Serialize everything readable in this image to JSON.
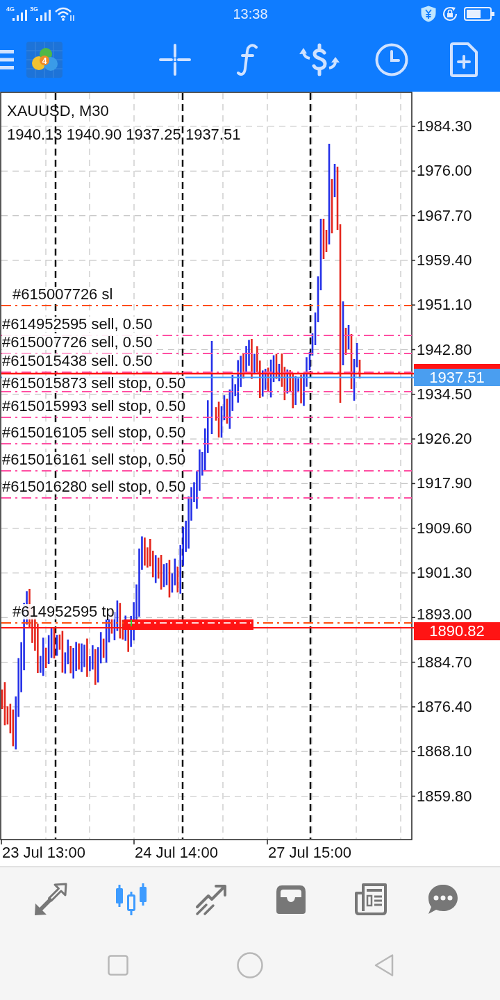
{
  "status_bar": {
    "network_labels": [
      "4G",
      "3G"
    ],
    "time": "13:38"
  },
  "toolbar": {
    "logo_badge": "4"
  },
  "chart": {
    "symbol": "XAUUSD, M30",
    "ohlc": "1940.13 1940.90 1937.25 1937.51",
    "price_scale": [
      "1984.30",
      "1976.00",
      "1967.70",
      "1959.40",
      "1951.10",
      "1942.80",
      "1934.50",
      "1926.20",
      "1917.90",
      "1909.60",
      "1901.30",
      "1893.00",
      "1884.70",
      "1876.40",
      "1868.10",
      "1859.80"
    ],
    "time_scale": [
      "23 Jul 13:00",
      "24 Jul 14:00",
      "27 Jul 15:00"
    ],
    "order_lines": [
      {
        "kind": "sl",
        "label": "#615007726 sl"
      },
      {
        "kind": "sell",
        "label": "#614952595 sell, 0.50"
      },
      {
        "kind": "sell",
        "label": "#615007726 sell, 0.50"
      },
      {
        "kind": "sell",
        "label": "#615015438 sell. 0.50"
      },
      {
        "kind": "sellstop",
        "label": "#615015873 sell stop, 0.50"
      },
      {
        "kind": "sellstop",
        "label": "#615015993 sell stop, 0.50"
      },
      {
        "kind": "sellstop",
        "label": "#615016105 sell stop, 0.50"
      },
      {
        "kind": "sellstop",
        "label": "#615016161 sell stop, 0.50"
      },
      {
        "kind": "sellstop",
        "label": "#615016280 sell stop, 0.50"
      },
      {
        "kind": "tp",
        "label": "#614952595 tp"
      }
    ],
    "bid_price": "1937.51",
    "level_price": "1890.82"
  },
  "bottom_nav": [
    {
      "kind": "arrows",
      "selected": false
    },
    {
      "kind": "candles",
      "selected": true
    },
    {
      "kind": "trend",
      "selected": false
    },
    {
      "kind": "inbox",
      "selected": false
    },
    {
      "kind": "newspaper",
      "selected": false
    },
    {
      "kind": "chat",
      "selected": false
    }
  ]
}
